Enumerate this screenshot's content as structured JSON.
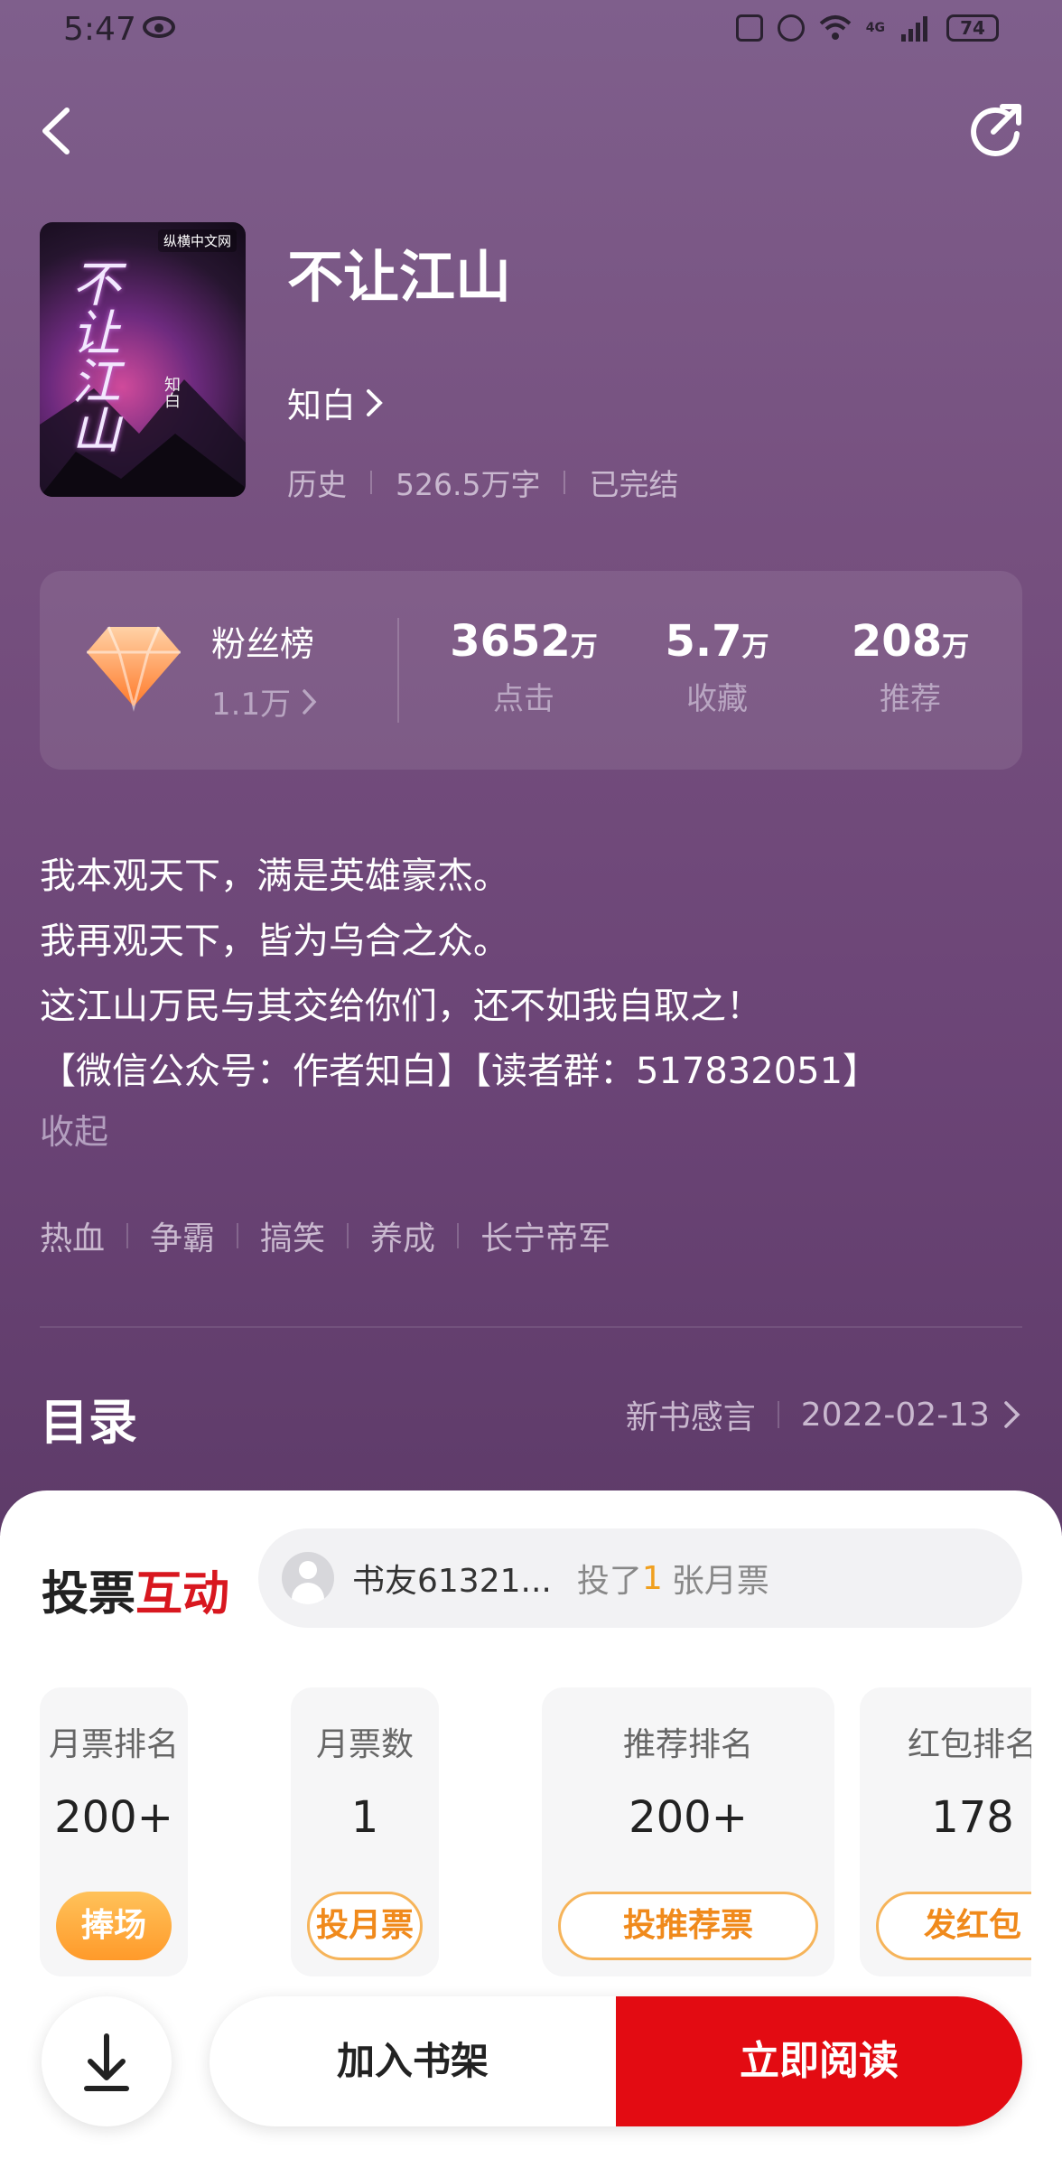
{
  "status_bar": {
    "time": "5:47",
    "battery": "74",
    "network": "4G"
  },
  "book": {
    "title": "不让江山",
    "cover_title": "不让江山",
    "cover_logo": "纵横中文网",
    "cover_author": "知白",
    "author": "知白",
    "genre": "历史",
    "word_count": "526.5万字",
    "status": "已完结"
  },
  "stats": {
    "fans_label": "粉丝榜",
    "fans_count": "1.1万",
    "items": [
      {
        "num": "3652",
        "unit": "万",
        "label": "点击"
      },
      {
        "num": "5.7",
        "unit": "万",
        "label": "收藏"
      },
      {
        "num": "208",
        "unit": "万",
        "label": "推荐"
      }
    ]
  },
  "intro": {
    "lines": [
      "我本观天下，满是英雄豪杰。",
      "我再观天下，皆为乌合之众。",
      "这江山万民与其交给你们，还不如我自取之！",
      "【微信公众号：作者知白】【读者群：517832051】"
    ],
    "collapse_label": "收起"
  },
  "tags": [
    "热血",
    "争霸",
    "搞笑",
    "养成",
    "长宁帝军"
  ],
  "toc": {
    "title": "目录",
    "latest_chapter": "新书感言",
    "date": "2022-02-13"
  },
  "vote": {
    "title_a": "投票",
    "title_b": "互动",
    "ticker": {
      "user": "书友61321...",
      "action": "投了",
      "count": "1",
      "suffix": "张月票"
    },
    "cards": [
      {
        "title": "月票排名",
        "value": "200+",
        "button": "捧场"
      },
      {
        "title": "月票数",
        "value": "1",
        "button": "投月票"
      },
      {
        "title": "推荐排名",
        "value": "200+",
        "button": "投推荐票"
      },
      {
        "title": "红包排名",
        "value": "178",
        "button": "发红包"
      }
    ]
  },
  "bottom": {
    "add_shelf": "加入书架",
    "read_now": "立即阅读"
  },
  "colors": {
    "accent_red": "#e30b12",
    "orange": "#f08a1c",
    "bg_purple": "#76507f"
  }
}
